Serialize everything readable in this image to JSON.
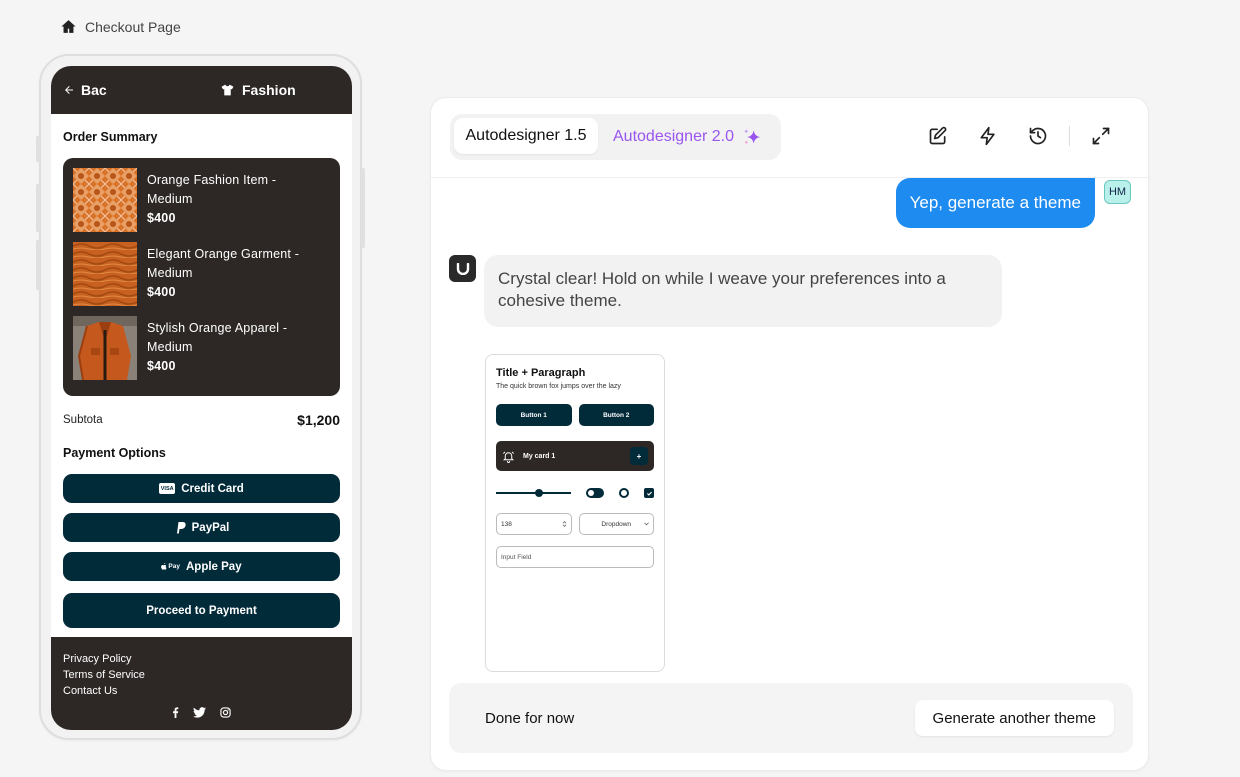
{
  "breadcrumb": {
    "label": "Checkout Page"
  },
  "phone": {
    "back_label": "Bac",
    "brand_label": "Fashion",
    "order_summary_title": "Order Summary",
    "items": [
      {
        "name": "Orange Fashion Item -",
        "variant": "Medium",
        "price": "$400"
      },
      {
        "name": "Elegant Orange Garment -",
        "variant": "Medium",
        "price": "$400"
      },
      {
        "name": "Stylish Orange Apparel -",
        "variant": "Medium",
        "price": "$400"
      }
    ],
    "subtotal_label": "Subtota",
    "subtotal_value": "$1,200",
    "payment_title": "Payment Options",
    "payments": [
      "Credit Card",
      "PayPal",
      "Apple Pay"
    ],
    "visa_badge": "VISA",
    "apple_pay_badge": "Pay",
    "proceed_label": "Proceed to Payment",
    "footer_links": [
      "Privacy Policy",
      "Terms of Service",
      "Contact Us"
    ]
  },
  "panel": {
    "tab1": "Autodesigner 1.5",
    "tab2": "Autodesigner 2.0",
    "user_message": "Yep, generate a theme",
    "user_initials": "HM",
    "bot_message": "Crystal clear! Hold on while I weave your preferences into a cohesive theme.",
    "preview": {
      "title": "Title + Paragraph",
      "paragraph": "The quick brown fox jumps over the lazy",
      "button1": "Button 1",
      "button2": "Button 2",
      "card_label": "My card 1",
      "card_plus": "+",
      "number_value": "138",
      "dropdown_label": "Dropdown",
      "input_placeholder": "Input Field",
      "slider_value": 0.58
    },
    "done_label": "Done for now",
    "generate_label": "Generate another theme"
  },
  "colors": {
    "accent_blue": "#1e8bf0",
    "dark_navy": "#022b3a",
    "dark_brown": "#2d2826",
    "purple": "#9a55f0"
  }
}
